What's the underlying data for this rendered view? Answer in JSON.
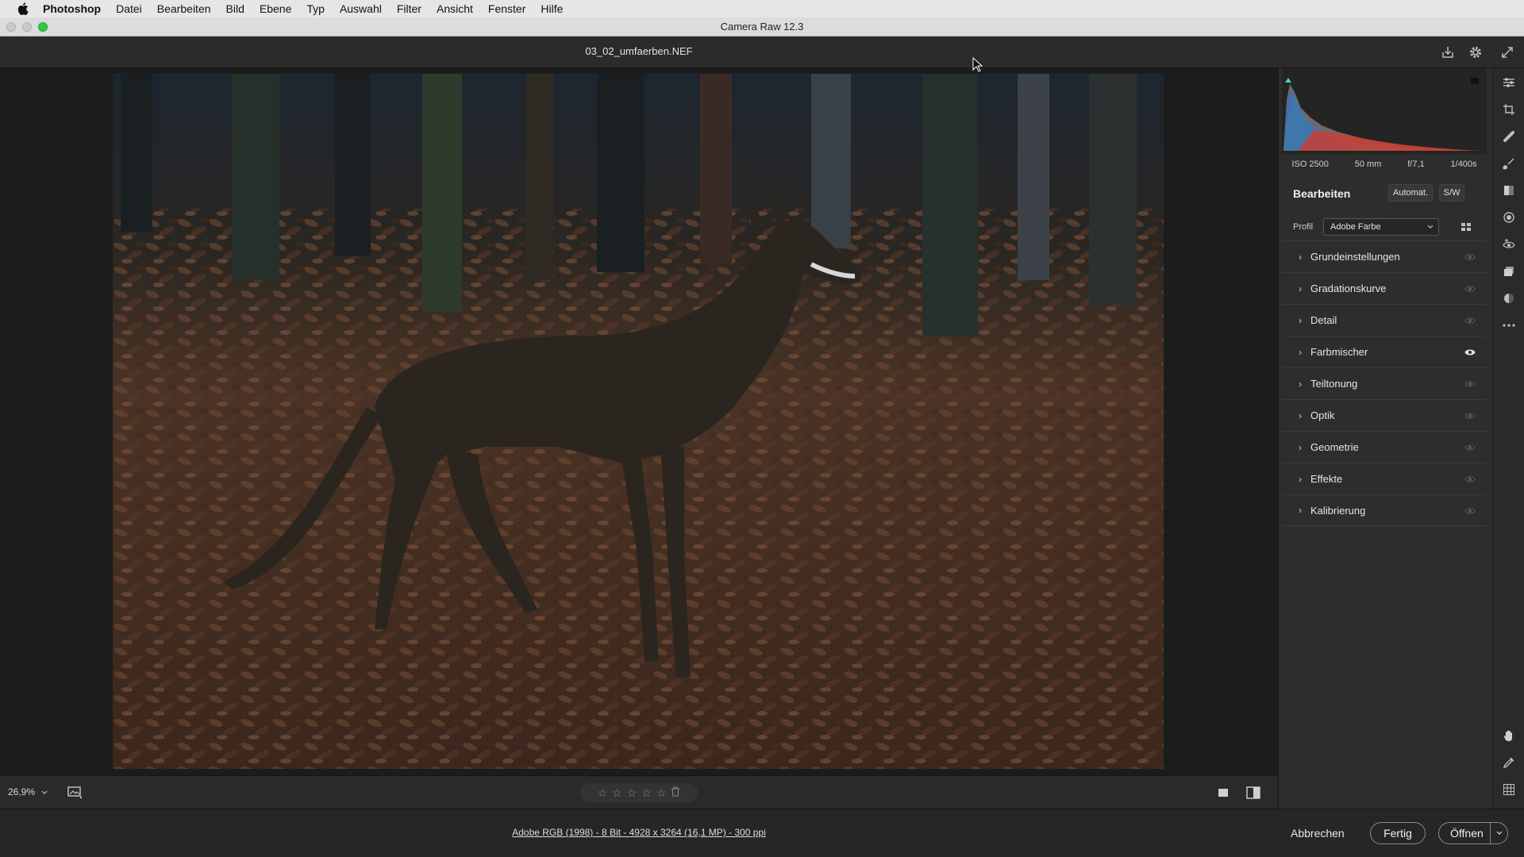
{
  "menubar": {
    "app_name": "Photoshop",
    "items": [
      "Datei",
      "Bearbeiten",
      "Bild",
      "Ebene",
      "Typ",
      "Auswahl",
      "Filter",
      "Ansicht",
      "Fenster",
      "Hilfe"
    ]
  },
  "window": {
    "title": "Camera Raw 12.3"
  },
  "header": {
    "filename": "03_02_umfaerben.NEF"
  },
  "viewer": {
    "zoom": "26,9%",
    "rating_stars": 5
  },
  "footer": {
    "file_info": "Adobe RGB (1998) - 8 Bit - 4928 x 3264 (16,1 MP) - 300 ppi",
    "cancel": "Abbrechen",
    "done": "Fertig",
    "open": "Öffnen"
  },
  "panel": {
    "exif": {
      "iso": "ISO 2500",
      "focal": "50 mm",
      "aperture": "f/7,1",
      "shutter": "1/400s"
    },
    "edit_title": "Bearbeiten",
    "auto_button": "Automat.",
    "bw_button": "S/W",
    "profile_label": "Profil",
    "profile_value": "Adobe Farbe",
    "sections": [
      {
        "label": "Grundeinstellungen",
        "eye_active": false
      },
      {
        "label": "Gradationskurve",
        "eye_active": false
      },
      {
        "label": "Detail",
        "eye_active": false
      },
      {
        "label": "Farbmischer",
        "eye_active": true
      },
      {
        "label": "Teiltonung",
        "eye_active": false
      },
      {
        "label": "Optik",
        "eye_active": false
      },
      {
        "label": "Geometrie",
        "eye_active": false
      },
      {
        "label": "Effekte",
        "eye_active": false
      },
      {
        "label": "Kalibrierung",
        "eye_active": false
      }
    ]
  },
  "icons": {
    "toolstrip": [
      "edit-sliders-icon",
      "crop-icon",
      "healing-icon",
      "brush-icon",
      "gradient-icon",
      "radial-icon",
      "redeye-icon",
      "snapshots-icon",
      "presets-icon",
      "more-icon",
      "hand-icon",
      "eyedropper-icon",
      "grid-icon"
    ]
  },
  "colors": {
    "accent_green": "#34c84a",
    "panel_bg": "#2d2d2d"
  }
}
